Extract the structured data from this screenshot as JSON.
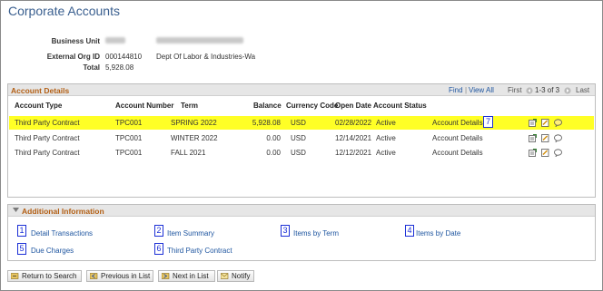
{
  "page": {
    "title": "Corporate Accounts"
  },
  "summary": {
    "business_unit_label": "Business Unit",
    "external_org_label": "External Org ID",
    "external_org_id": "000144810",
    "external_org_name": "Dept Of Labor & Industries-Wa",
    "total_label": "Total",
    "total_value": "5,928.08"
  },
  "account_details": {
    "title": "Account Details",
    "nav": {
      "find": "Find",
      "sep": "|",
      "view_all": "View All",
      "first": "First",
      "range": "1-3 of 3",
      "last": "Last"
    },
    "columns": [
      "Account Type",
      "Account Number",
      "Term",
      "Balance",
      "Currency Code",
      "Open Date",
      "Account Status"
    ],
    "rows": [
      {
        "type": "Third Party Contract",
        "number": "TPC001",
        "term": "SPRING 2022",
        "balance": "5,928.08",
        "currency": "USD",
        "open_date": "02/28/2022",
        "status": "Active",
        "link": "Account Details",
        "highlighted": true
      },
      {
        "type": "Third Party Contract",
        "number": "TPC001",
        "term": "WINTER 2022",
        "balance": "0.00",
        "currency": "USD",
        "open_date": "12/14/2021",
        "status": "Active",
        "link": "Account Details",
        "highlighted": false
      },
      {
        "type": "Third Party Contract",
        "number": "TPC001",
        "term": "FALL 2021",
        "balance": "0.00",
        "currency": "USD",
        "open_date": "12/12/2021",
        "status": "Active",
        "link": "Account Details",
        "highlighted": false
      }
    ],
    "callout": "7"
  },
  "additional_info": {
    "title": "Additional Information",
    "links": [
      {
        "num": "1",
        "label": "Detail Transactions"
      },
      {
        "num": "2",
        "label": "Item Summary"
      },
      {
        "num": "3",
        "label": "Items by Term"
      },
      {
        "num": "4",
        "label": "Items by Date"
      },
      {
        "num": "5",
        "label": "Due Charges"
      },
      {
        "num": "6",
        "label": "Third Party Contract"
      }
    ]
  },
  "toolbar": {
    "return": "Return to Search",
    "previous": "Previous in List",
    "next": "Next in List",
    "notify": "Notify"
  },
  "colors": {
    "accent": "#b35f14",
    "link": "#1f56a0",
    "highlight": "#ffff26",
    "callout": "#1b2fd6"
  }
}
